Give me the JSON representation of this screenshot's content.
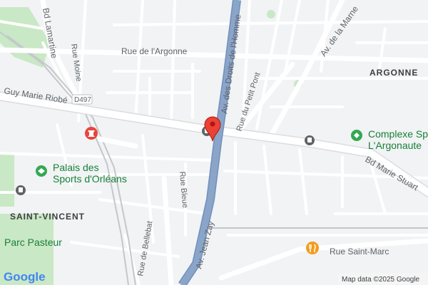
{
  "map": {
    "streets": {
      "bd_lamartine": "Bd Lamartine",
      "rue_moine": "Rue Moine",
      "rue_argonne": "Rue de l'Argonne",
      "av_droits_homme": "Av. des Droits de l'Homme",
      "av_marne": "Av. de la Marne",
      "guy_marie_riobe": "Guy Marie Riobé",
      "rue_petit_pont": "Rue du Petit Pont",
      "bd_marie_stuart": "Bd Marie Stuart",
      "rue_bleue": "Rue Bleue",
      "rue_bellebat": "Rue de Bellebat",
      "av_jean_zay": "Av. Jean Zay",
      "rue_saint_marc": "Rue Saint-Marc"
    },
    "route_shield": "D497",
    "areas": {
      "argonne": "ARGONNE",
      "saint_vincent": "SAINT-VINCENT"
    },
    "pois": {
      "palais_line1": "Palais des",
      "palais_line2": "Sports d'Orléans",
      "complexe_line1": "Complexe Sp",
      "complexe_line2": "L'Argonaute",
      "parc_pasteur": "Parc Pasteur"
    },
    "icons": {
      "pin": "map-pin-icon",
      "palais": "stadium-icon",
      "complexe": "sports-complex-icon",
      "restaurant": "restaurant-icon",
      "monument": "monument-icon",
      "transit": "bus-icon"
    },
    "colors": {
      "background": "#f1f3f4",
      "road": "#ffffff",
      "main_road": "#8ba5c9",
      "park": "#c9e8c5",
      "pin": "#ea4335",
      "restaurant": "#f39c1c",
      "poi_green": "#34a853",
      "rail": "#c4c7cb"
    }
  },
  "footer": {
    "logo": "Google",
    "attribution": "Map data ©2025 Google"
  }
}
